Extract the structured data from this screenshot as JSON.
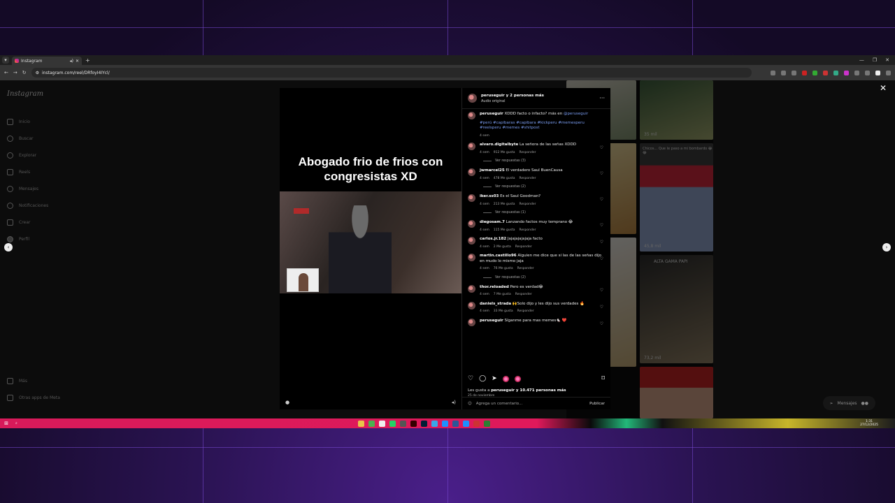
{
  "browser": {
    "tab_title": "Instagram",
    "url": "instagram.com/reel/DRfoyI4IYcl/"
  },
  "sidebar": {
    "logo": "Instagram",
    "items": [
      {
        "label": "Inicio",
        "icon": "home-icon"
      },
      {
        "label": "Buscar",
        "icon": "search-icon"
      },
      {
        "label": "Explorar",
        "icon": "compass-icon"
      },
      {
        "label": "Reels",
        "icon": "reels-icon"
      },
      {
        "label": "Mensajes",
        "icon": "messenger-icon"
      },
      {
        "label": "Notificaciones",
        "icon": "heart-icon"
      },
      {
        "label": "Crear",
        "icon": "plus-icon"
      },
      {
        "label": "Perfil",
        "icon": "avatar-icon"
      }
    ],
    "bottom": [
      {
        "label": "Más",
        "icon": "menu-icon"
      },
      {
        "label": "Otras apps de Meta",
        "icon": "meta-icon"
      }
    ]
  },
  "video": {
    "title_line1": "Abogado frio de frios con",
    "title_line2": "congresistas XD"
  },
  "post": {
    "header_user": "peruseguir y 2 personas más",
    "audio": "Audio original",
    "caption_user": "peruseguir",
    "caption_text": "XDDD facto o infacto? más en",
    "caption_mention": "@peruseguir",
    "hashtags": "#perú #capibaras #capibara #kickperu #memesperu #reelsperu #memes #shitpost",
    "caption_time": "4 sem",
    "comments": [
      {
        "user": "alvaro.digitalbyte",
        "text": "La señora de las señas XDDD",
        "time": "4 sem",
        "likes": "912 Me gusta",
        "reply": "Responder",
        "replies": "Ver respuestas (3)"
      },
      {
        "user": "jwmarcel25",
        "text": "El verdadero Saul BuenCausa",
        "time": "4 sem",
        "likes": "478 Me gusta",
        "reply": "Responder",
        "replies": "Ver respuestas (2)"
      },
      {
        "user": "iker.ss03",
        "text": "Es el Saul Goodman?",
        "time": "4 sem",
        "likes": "213 Me gusta",
        "reply": "Responder",
        "replies": "Ver respuestas (1)"
      },
      {
        "user": "diegosam.7",
        "text": "Lanzando factos muy temprano 😂",
        "time": "4 sem",
        "likes": "115 Me gusta",
        "reply": "Responder",
        "replies": ""
      },
      {
        "user": "carlos.jr.182",
        "text": "Jajajajajajaja facto",
        "time": "4 sem",
        "likes": "2 Me gusta",
        "reply": "Responder",
        "replies": ""
      },
      {
        "user": "martin.castillo96",
        "text": "Alguien me dice que si las de las señas dijo en mudo lo mismo jaja",
        "time": "4 sem",
        "likes": "76 Me gusta",
        "reply": "Responder",
        "replies": "Ver respuestas (2)"
      },
      {
        "user": "thor.reloaded",
        "text": "Pero es verdad😂",
        "time": "4 sem",
        "likes": "7 Me gusta",
        "reply": "Responder",
        "replies": ""
      },
      {
        "user": "daniels_strada",
        "text": "🙌Solo dijo y les dijo sus verdades 🔥",
        "time": "4 sem",
        "likes": "33 Me gusta",
        "reply": "Responder",
        "replies": ""
      },
      {
        "user": "peruseguir",
        "text": "Síganme para mas memes🐁 ❤️",
        "time": "",
        "likes": "",
        "reply": "",
        "replies": ""
      }
    ],
    "likes_prefix": "Les gusta a",
    "likes_user": "peruseguir y 10.471 personas más",
    "date": "25 de noviembre",
    "comment_placeholder": "Agrega un comentario...",
    "publish": "Publicar"
  },
  "background_grid": {
    "views": [
      "35 mil",
      "45,8 mil",
      "73,2 mil"
    ],
    "caption_1": "Chicos... Que le paso a mi bombardo 😂😂",
    "caption_2": "ALTA GAMA PAPI"
  },
  "messages_pill": "Mensajes",
  "taskbar": {
    "time": "1:31",
    "date": "27/12/2025"
  },
  "colors": {
    "accent": "#0095f6",
    "taskbar": "#e0195b",
    "desktop": "#2a1352"
  }
}
